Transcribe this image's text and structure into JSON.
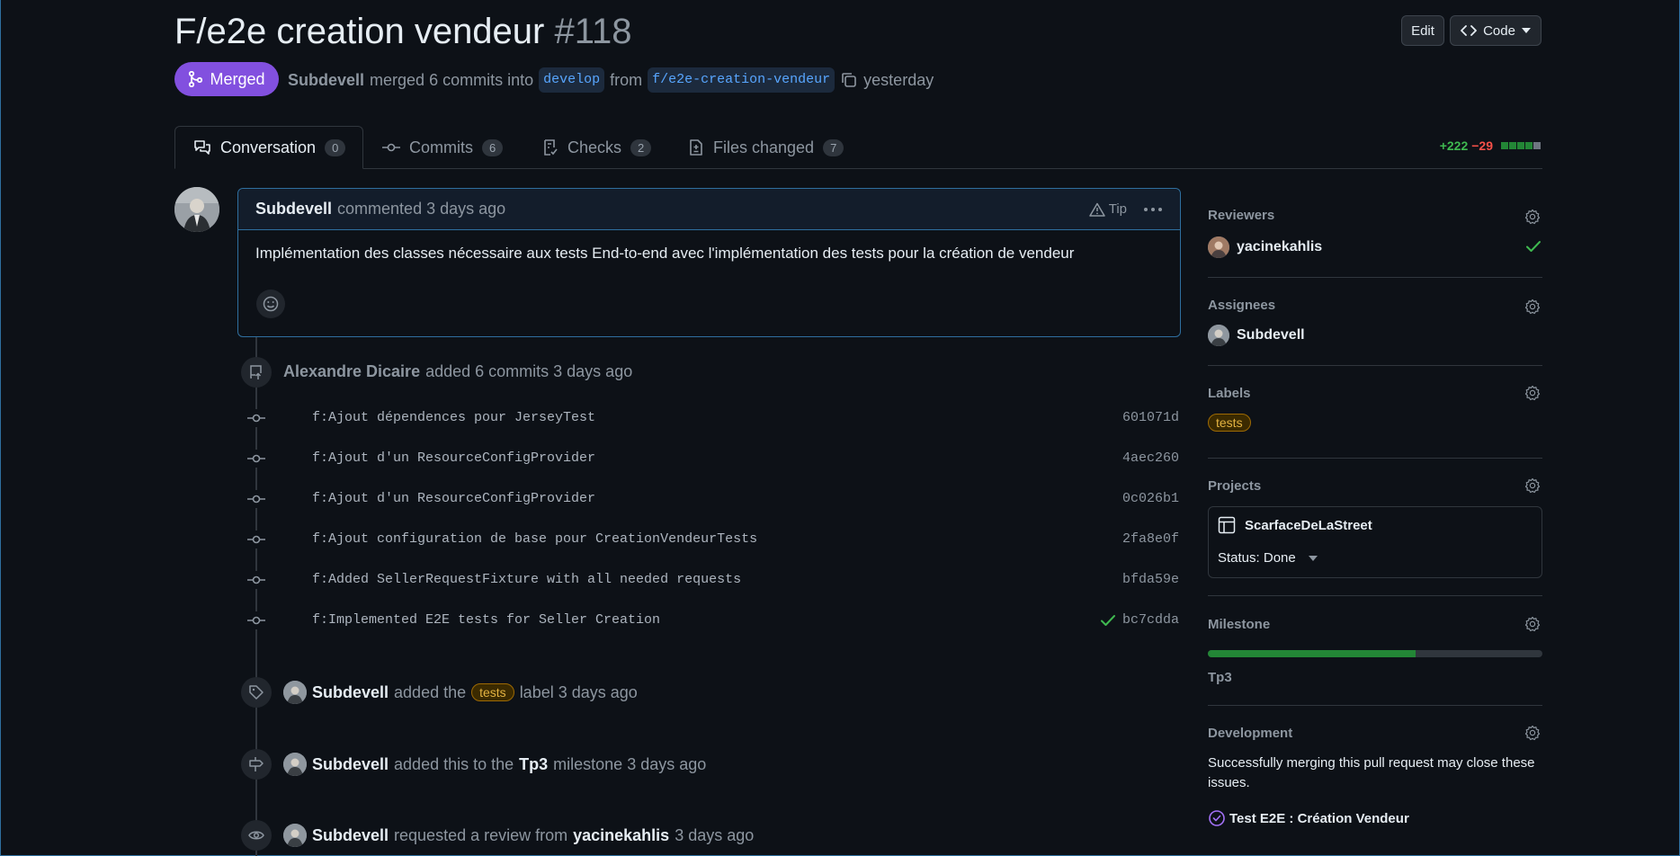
{
  "header": {
    "title": "F/e2e creation vendeur",
    "number": "#118",
    "edit_label": "Edit",
    "code_label": "Code",
    "state": "Merged",
    "author": "Subdevell",
    "merge_text": "merged 6 commits into",
    "base_branch": "develop",
    "from_text": "from",
    "head_branch": "f/e2e-creation-vendeur",
    "time": "yesterday"
  },
  "tabs": [
    {
      "label": "Conversation",
      "count": "0"
    },
    {
      "label": "Commits",
      "count": "6"
    },
    {
      "label": "Checks",
      "count": "2"
    },
    {
      "label": "Files changed",
      "count": "7"
    }
  ],
  "diffstat": {
    "additions": "+222",
    "deletions": "−29"
  },
  "comment": {
    "author": "Subdevell",
    "meta": "commented 3 days ago",
    "tip": "Tip",
    "body": "Implémentation des classes nécessaire aux tests End-to-end avec l'implémentation des tests pour la création de vendeur"
  },
  "commits_event": {
    "actor": "Alexandre Dicaire",
    "text": "added 6 commits 3 days ago",
    "commits": [
      {
        "message": "f:Ajout dépendences pour JerseyTest",
        "sha": "601071d"
      },
      {
        "message": "f:Ajout d'un ResourceConfigProvider",
        "sha": "4aec260"
      },
      {
        "message": "f:Ajout d'un ResourceConfigProvider",
        "sha": "0c026b1"
      },
      {
        "message": "f:Ajout configuration de base pour CreationVendeurTests",
        "sha": "2fa8e0f"
      },
      {
        "message": "f:Added SellerRequestFixture with all needed requests",
        "sha": "bfda59e"
      },
      {
        "message": "f:Implemented E2E tests for Seller Creation",
        "sha": "bc7cdda"
      }
    ]
  },
  "events": {
    "label_actor": "Subdevell",
    "label_pre": "added the",
    "label_name": "tests",
    "label_post": "label 3 days ago",
    "milestone_actor": "Subdevell",
    "milestone_pre": "added this to the",
    "milestone_name": "Tp3",
    "milestone_post": "milestone 3 days ago",
    "review_actor": "Subdevell",
    "review_pre": "requested a review from",
    "review_user": "yacinekahlis",
    "review_post": "3 days ago"
  },
  "sidebar": {
    "reviewers_title": "Reviewers",
    "reviewer": "yacinekahlis",
    "assignees_title": "Assignees",
    "assignee": "Subdevell",
    "labels_title": "Labels",
    "label": "tests",
    "projects_title": "Projects",
    "project_name": "ScarfaceDeLaStreet",
    "project_status": "Status: Done",
    "milestone_title": "Milestone",
    "milestone_name": "Tp3",
    "milestone_progress": 0.62,
    "development_title": "Development",
    "development_text": "Successfully merging this pull request may close these issues.",
    "issue": "Test E2E : Création Vendeur"
  },
  "colors": {
    "merged": "#8250df",
    "accent": "#58a6ff",
    "success": "#3fb950",
    "danger": "#f85149",
    "label_fg": "#e3b341"
  }
}
